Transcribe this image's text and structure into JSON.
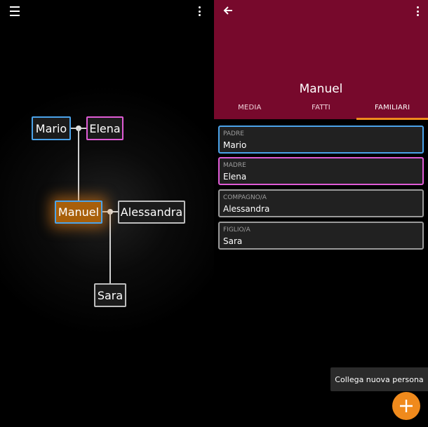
{
  "tree_view": {
    "menu_icon": "hamburger-menu-icon",
    "more_icon": "more-vert-icon",
    "people": {
      "mario": "Mario",
      "elena": "Elena",
      "manuel": "Manuel",
      "alessandra": "Alessandra",
      "sara": "Sara"
    },
    "colors": {
      "male": "#4ba3ea",
      "female": "#e05cd6",
      "unknown": "#bdbdbd",
      "selected": "#a85f0a"
    }
  },
  "detail": {
    "back_icon": "arrow-back-icon",
    "more_icon": "more-vert-icon",
    "header_color": "#77092c",
    "title": "Manuel",
    "tabs": [
      "MEDIA",
      "FATTI",
      "FAMILIARI"
    ],
    "active_tab": "FAMILIARI",
    "relatives": [
      {
        "label": "PADRE",
        "name": "Mario"
      },
      {
        "label": "MADRE",
        "name": "Elena"
      },
      {
        "label": "COMPAGNO/A",
        "name": "Alessandra"
      },
      {
        "label": "FIGLIO/A",
        "name": "Sara"
      }
    ],
    "tooltip": "Collega nuova persona",
    "fab_icon": "plus-icon",
    "accent": "#f08a1c"
  }
}
